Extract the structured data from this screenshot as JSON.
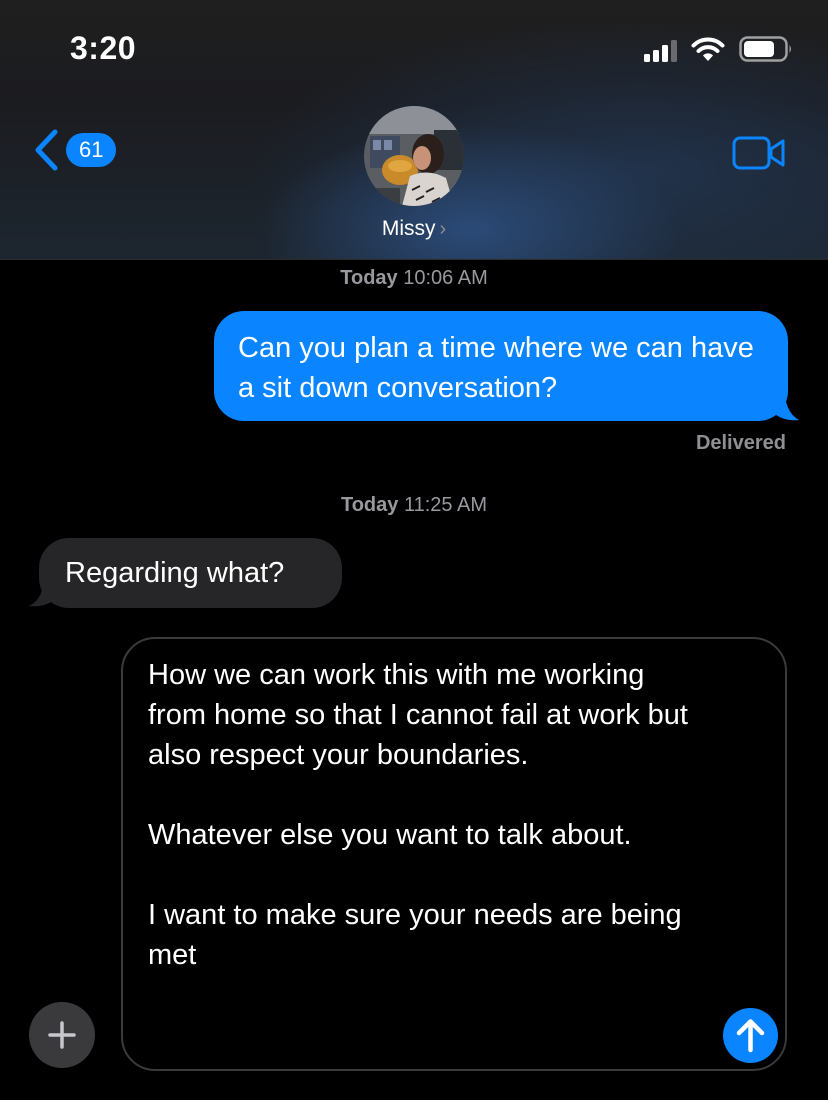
{
  "status_bar": {
    "time": "3:20"
  },
  "header": {
    "back_badge": "61",
    "contact_name": "Missy",
    "contact_chevron": "›"
  },
  "messages": [
    {
      "type": "timestamp",
      "day": "Today",
      "time": "10:06 AM"
    },
    {
      "type": "outgoing",
      "text": "Can you plan a time where we can have a sit down conversation?",
      "status": "Delivered"
    },
    {
      "type": "timestamp",
      "day": "Today",
      "time": "11:25 AM"
    },
    {
      "type": "incoming",
      "text": "Regarding what?"
    }
  ],
  "composer": {
    "text": "How we can work this with me working from home so that I cannot fail at work but also respect your boundaries.\n\nWhatever else you want to talk about.\n\nI want to make sure your needs are being met"
  },
  "icons": {
    "back": "chevron-left-icon",
    "video": "video-camera-icon",
    "add": "plus-icon",
    "send": "arrow-up-icon"
  },
  "colors": {
    "accent": "#0a84ff",
    "incoming_bubble": "#262628",
    "background": "#000000"
  }
}
